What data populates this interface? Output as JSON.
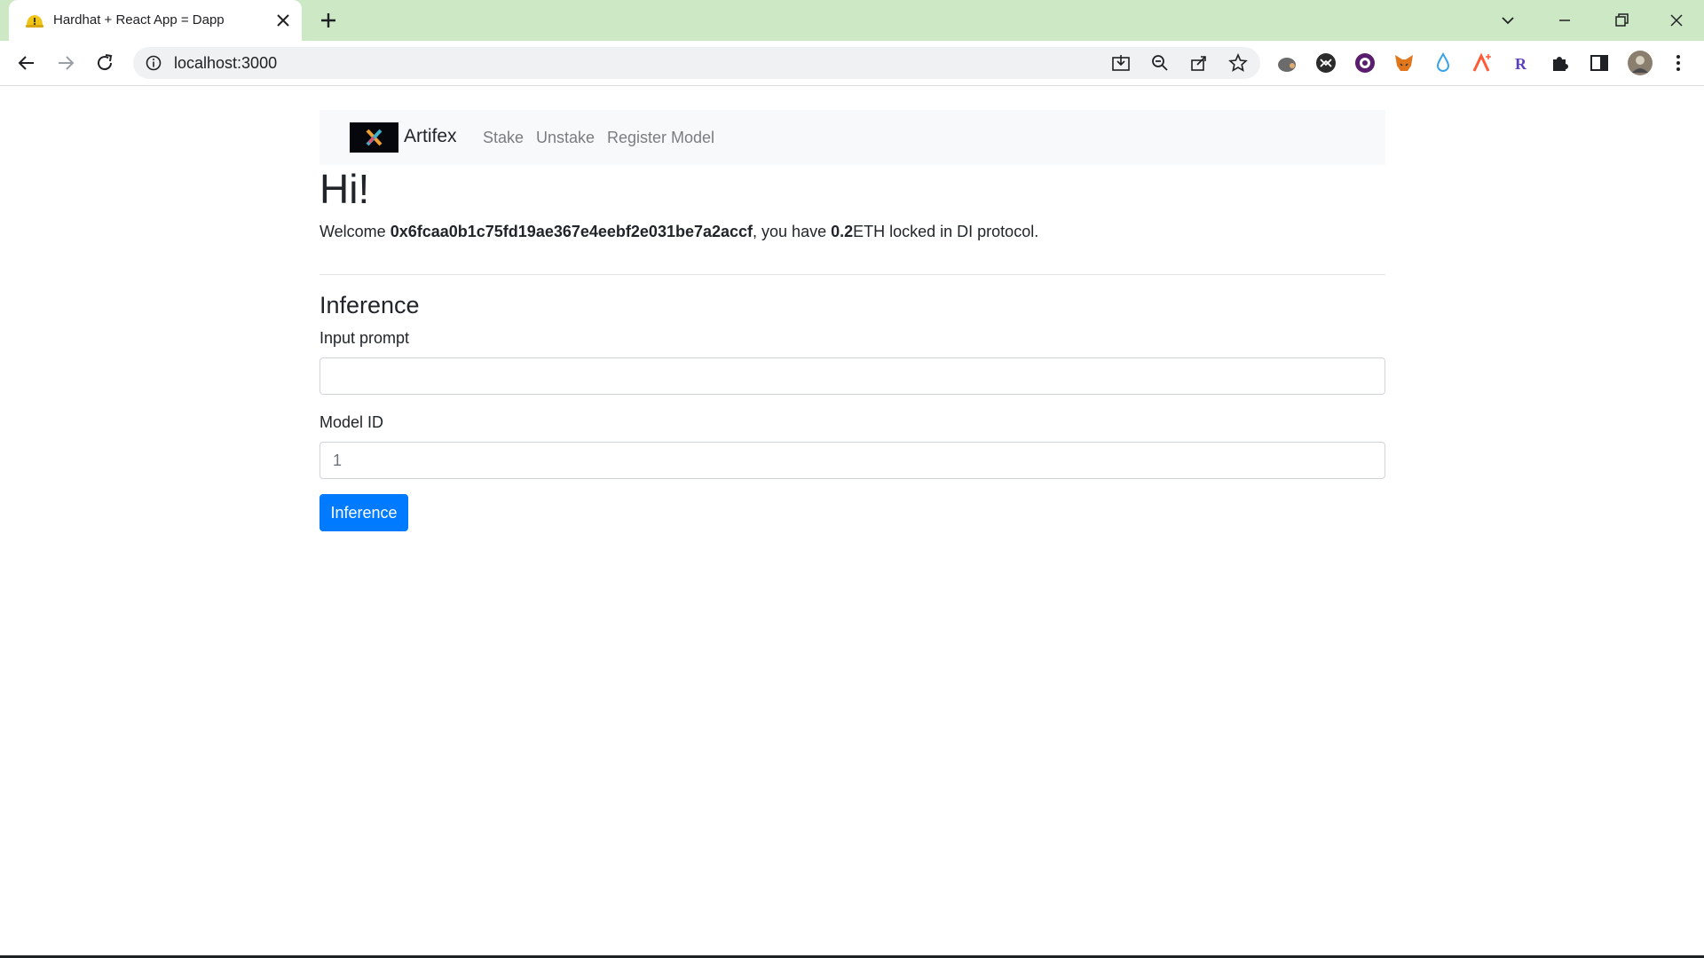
{
  "browser": {
    "tab_title": "Hardhat + React App = Dapp",
    "url": "localhost:3000",
    "tabstrip_color": "#cce8c4"
  },
  "navbar": {
    "brand": "Artifex",
    "links": [
      "Stake",
      "Unstake",
      "Register Model"
    ]
  },
  "greeting": "Hi!",
  "welcome": {
    "prefix": "Welcome ",
    "address": "0x6fcaa0b1c75fd19ae367e4eebf2e031be7a2accf",
    "middle": ", you have ",
    "amount": "0.2",
    "suffix": "ETH locked in DI protocol."
  },
  "form": {
    "title": "Inference",
    "prompt_label": "Input prompt",
    "prompt_value": "",
    "model_label": "Model ID",
    "model_placeholder": "1",
    "submit_label": "Inference"
  },
  "colors": {
    "primary": "#007bff",
    "navbar_bg": "#f8f9fa"
  }
}
